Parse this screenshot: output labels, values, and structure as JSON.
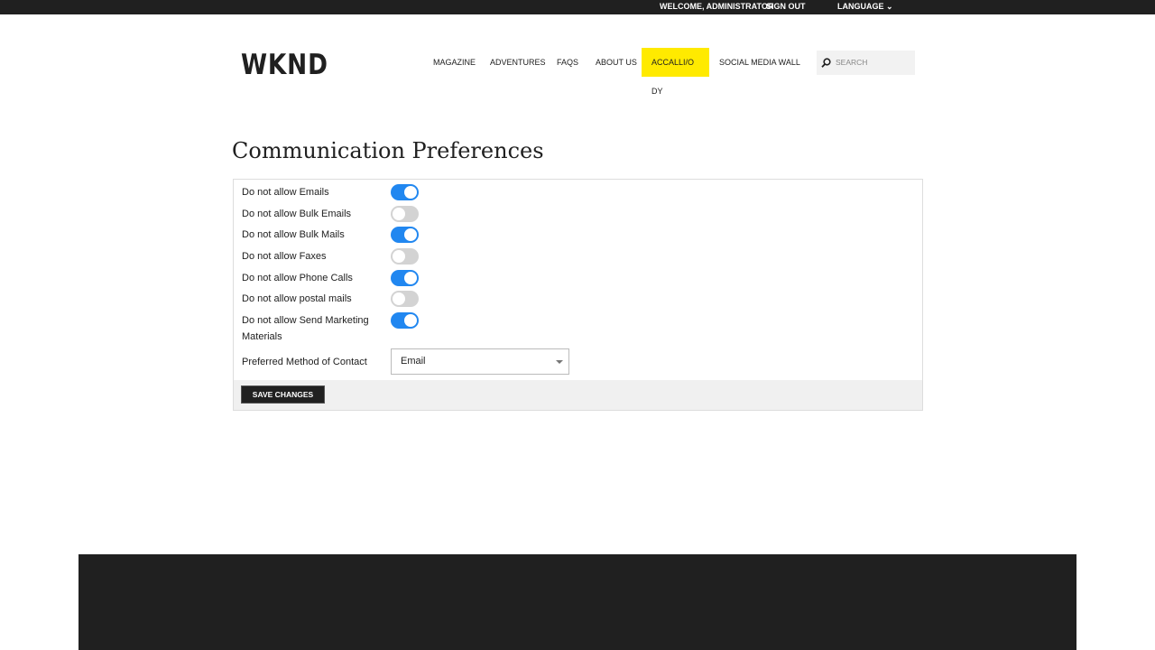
{
  "topbar": {
    "welcome": "WELCOME, ADMINISTRATOR",
    "sign_out": "SIGN OUT",
    "language": "LANGUAGE"
  },
  "logo": "WKND",
  "nav": [
    {
      "label": "MAGAZINE"
    },
    {
      "label": "ADVENTURES"
    },
    {
      "label": "FAQS"
    },
    {
      "label": "ABOUT US"
    },
    {
      "label": "ACCALLI/O DY",
      "active": true
    },
    {
      "label": "SOCIAL MEDIA WALL"
    }
  ],
  "search": {
    "placeholder": "SEARCH"
  },
  "page_title": "Communication Preferences",
  "preferences": [
    {
      "label": "Do not allow Emails",
      "on": true
    },
    {
      "label": "Do not allow Bulk Emails",
      "on": false
    },
    {
      "label": "Do not allow Bulk Mails",
      "on": true
    },
    {
      "label": "Do not allow Faxes",
      "on": false
    },
    {
      "label": "Do not allow Phone Calls",
      "on": true
    },
    {
      "label": "Do not allow postal mails",
      "on": false
    },
    {
      "label": "Do not allow Send Marketing Materials",
      "on": true
    }
  ],
  "contact": {
    "label": "Preferred Method of Contact",
    "value": "Email"
  },
  "save_label": "SAVE CHANGES",
  "colors": {
    "accent": "#2187f0",
    "nav_active": "#ffea00",
    "dark": "#202020"
  }
}
